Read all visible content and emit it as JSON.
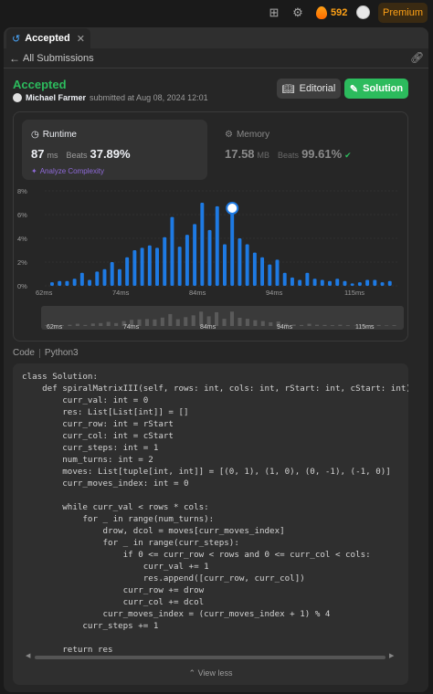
{
  "topbar": {
    "streak_count": "592",
    "premium_label": "Premium"
  },
  "tab": {
    "label": "Accepted"
  },
  "subnav": {
    "all_submissions": "All Submissions"
  },
  "submission": {
    "status": "Accepted",
    "author": "Michael Farmer",
    "submitted_text": "submitted at Aug 08, 2024 12:01",
    "editorial_label": "Editorial",
    "solution_label": "Solution"
  },
  "runtime": {
    "title": "Runtime",
    "value": "87",
    "unit": "ms",
    "beats_label": "Beats",
    "beats": "37.89%",
    "analyze": "Analyze Complexity"
  },
  "memory": {
    "title": "Memory",
    "value": "17.58",
    "unit": "MB",
    "beats_label": "Beats",
    "beats": "99.61%"
  },
  "chart_data": {
    "type": "bar",
    "ylim": [
      0,
      8
    ],
    "ytick_labels": [
      "8%",
      "6%",
      "4%",
      "2%",
      "0%"
    ],
    "xtick_labels": [
      "62ms",
      "74ms",
      "84ms",
      "94ms",
      "115ms"
    ],
    "values": [
      0.3,
      0.4,
      0.4,
      0.6,
      1.1,
      0.5,
      1.2,
      1.4,
      2.0,
      1.4,
      2.4,
      3.0,
      3.2,
      3.4,
      3.2,
      4.1,
      5.8,
      3.3,
      4.3,
      5.2,
      7.0,
      4.7,
      6.7,
      3.5,
      7.0,
      4.0,
      3.5,
      2.8,
      2.4,
      1.8,
      2.2,
      1.1,
      0.7,
      0.5,
      1.1,
      0.6,
      0.5,
      0.4,
      0.6,
      0.4,
      0.2,
      0.3,
      0.5,
      0.5,
      0.3,
      0.4
    ],
    "highlight_index": 24,
    "colors": {
      "bar": "#1e7ae3",
      "highlight": "#ffffff",
      "grid": "#3a3a3a",
      "range_bar": "#5a5a5a"
    }
  },
  "code": {
    "label": "Code",
    "language": "Python3",
    "lines": [
      "class Solution:",
      "    def spiralMatrixIII(self, rows: int, cols: int, rStart: int, cStart: int) -> L",
      "        curr_val: int = 0",
      "        res: List[List[int]] = []",
      "        curr_row: int = rStart",
      "        curr_col: int = cStart",
      "        curr_steps: int = 1",
      "        num_turns: int = 2",
      "        moves: List[tuple[int, int]] = [(0, 1), (1, 0), (0, -1), (-1, 0)]",
      "        curr_moves_index: int = 0",
      "",
      "        while curr_val < rows * cols:",
      "            for _ in range(num_turns):",
      "                drow, dcol = moves[curr_moves_index]",
      "                for _ in range(curr_steps):",
      "                    if 0 <= curr_row < rows and 0 <= curr_col < cols:",
      "                        curr_val += 1",
      "                        res.append([curr_row, curr_col])",
      "                    curr_row += drow",
      "                    curr_col += dcol",
      "                curr_moves_index = (curr_moves_index + 1) % 4",
      "            curr_steps += 1",
      "",
      "        return res"
    ],
    "view_less": "View less"
  }
}
